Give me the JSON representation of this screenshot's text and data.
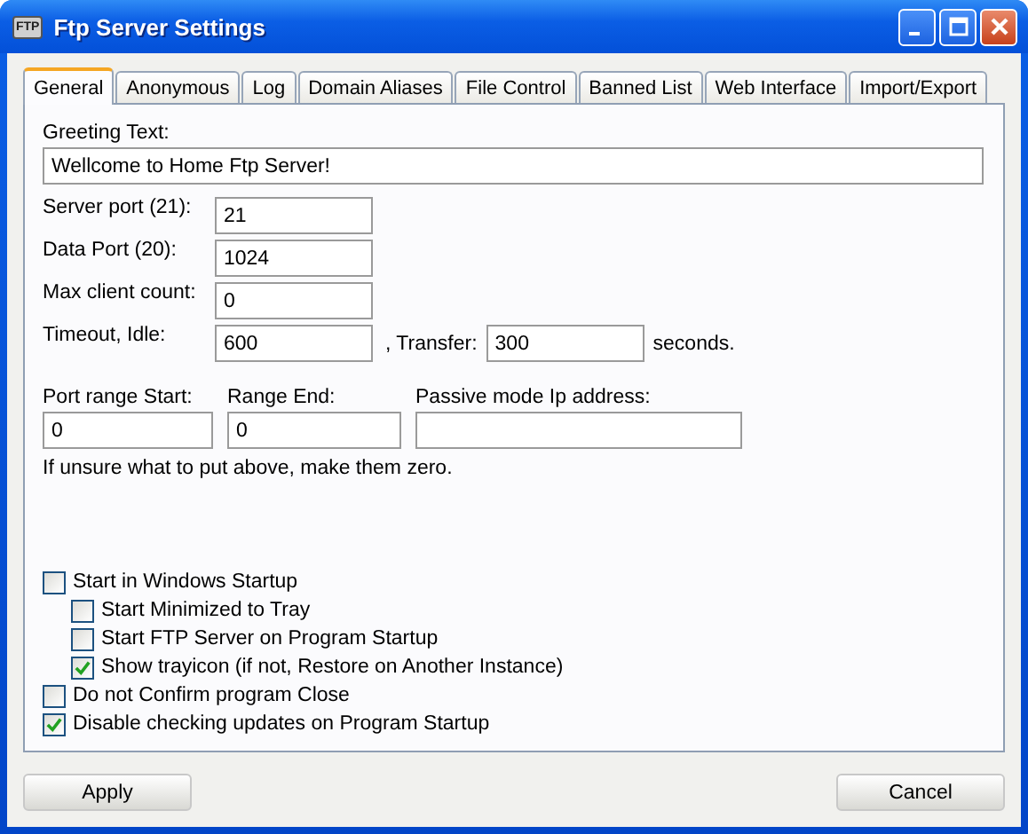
{
  "window": {
    "title": "Ftp Server Settings",
    "icon_text": "FTP"
  },
  "tabs": [
    {
      "label": "General",
      "selected": true
    },
    {
      "label": "Anonymous",
      "selected": false
    },
    {
      "label": "Log",
      "selected": false
    },
    {
      "label": "Domain Aliases",
      "selected": false
    },
    {
      "label": "File Control",
      "selected": false
    },
    {
      "label": "Banned List",
      "selected": false
    },
    {
      "label": "Web Interface",
      "selected": false
    },
    {
      "label": "Import/Export",
      "selected": false
    }
  ],
  "greeting": {
    "label": "Greeting Text:",
    "value": "Wellcome to Home Ftp Server!"
  },
  "fields": [
    {
      "label": "Server port (21):",
      "value": "21"
    },
    {
      "label": "Data Port (20):",
      "value": "1024"
    },
    {
      "label": "Max client count:",
      "value": "0"
    }
  ],
  "timeout": {
    "label": "Timeout, Idle:",
    "idle": "600",
    "transfer_label": ", Transfer:",
    "transfer": "300",
    "unit": "seconds."
  },
  "port_range": [
    {
      "label": "Port range Start:",
      "value": "0"
    },
    {
      "label": "Range End:",
      "value": "0"
    },
    {
      "label": "Passive mode Ip address:"
    }
  ],
  "hint": "If unsure what to put above, make them zero.",
  "options": [
    {
      "label": "Start in Windows Startup",
      "checked": false,
      "children": [
        {
          "label": "Start Minimized to Tray",
          "checked": false
        },
        {
          "label": "Start FTP Server on Program Startup",
          "checked": false
        },
        {
          "label": "Show trayicon (if not, Restore on Another Instance)",
          "checked": true
        }
      ]
    },
    {
      "label": "Do not Confirm program Close",
      "checked": false
    },
    {
      "label": "Disable checking updates on Program Startup",
      "checked": true
    }
  ],
  "buttons": [
    "Apply",
    "Cancel"
  ]
}
